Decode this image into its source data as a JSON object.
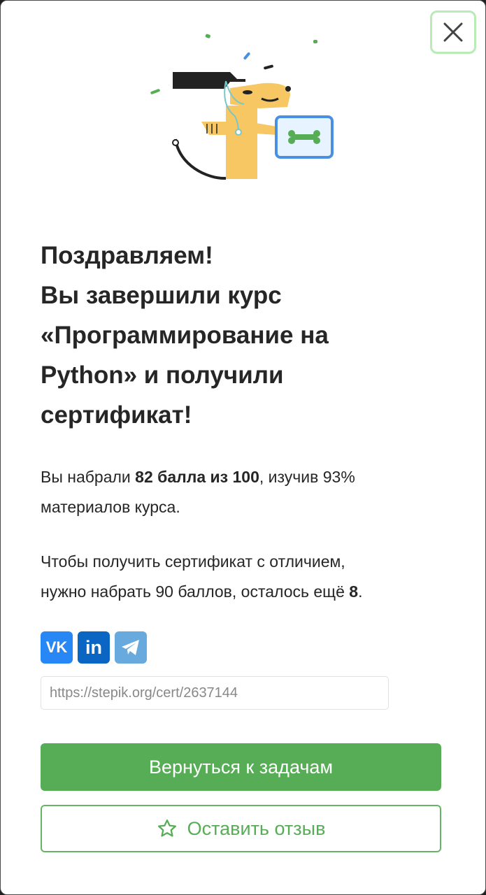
{
  "header": {
    "close_label": "Close"
  },
  "title": {
    "line1": "Поздравляем!",
    "line2": "Вы завершили курс",
    "line3": "«Программирование на",
    "line4": "Python» и получили",
    "line5": "сертификат!"
  },
  "score": {
    "prefix": "Вы набрали ",
    "bold": "82 балла из 100",
    "suffix": ", изучив 93%",
    "line2": "материалов курса."
  },
  "distinction": {
    "line1": "Чтобы получить сертификат с отличием,",
    "line2_prefix": "нужно набрать 90 баллов, осталось ещё ",
    "remaining": "8",
    "line2_suffix": "."
  },
  "share": {
    "vk_label": "VK",
    "linkedin_label": "in",
    "telegram_icon": "telegram-icon"
  },
  "certificate": {
    "url": "https://stepik.org/cert/2637144"
  },
  "buttons": {
    "back_label": "Вернуться к задачам",
    "review_label": "Оставить отзыв"
  },
  "colors": {
    "primary": "#56ad55",
    "close_border": "#b9ebb7",
    "vk": "#2787f5",
    "linkedin": "#0a66c2",
    "telegram": "#68a9de"
  }
}
